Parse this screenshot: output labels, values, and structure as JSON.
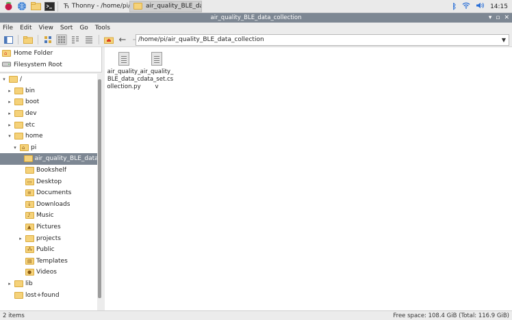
{
  "taskbar": {
    "tasks": [
      {
        "label": "Thonny  -  /home/pi/...",
        "icon": "thonny-icon"
      },
      {
        "label": "air_quality_BLE_data_...",
        "icon": "folder-icon"
      }
    ],
    "clock": "14:15"
  },
  "window": {
    "title": "air_quality_BLE_data_collection"
  },
  "menu": [
    "File",
    "Edit",
    "View",
    "Sort",
    "Go",
    "Tools"
  ],
  "toolbar": {
    "path": "/home/pi/air_quality_BLE_data_collection"
  },
  "places": [
    {
      "label": "Home Folder",
      "icon": "home-icon"
    },
    {
      "label": "Filesystem Root",
      "icon": "drive-icon"
    }
  ],
  "tree": [
    {
      "label": "/",
      "indent": 0,
      "expander": "▾",
      "glyph": ""
    },
    {
      "label": "bin",
      "indent": 1,
      "expander": "▸",
      "glyph": ""
    },
    {
      "label": "boot",
      "indent": 1,
      "expander": "▸",
      "glyph": ""
    },
    {
      "label": "dev",
      "indent": 1,
      "expander": "▸",
      "glyph": ""
    },
    {
      "label": "etc",
      "indent": 1,
      "expander": "▸",
      "glyph": ""
    },
    {
      "label": "home",
      "indent": 1,
      "expander": "▾",
      "glyph": ""
    },
    {
      "label": "pi",
      "indent": 2,
      "expander": "▾",
      "glyph": "⌂"
    },
    {
      "label": "air_quality_BLE_data_collection",
      "indent": 3,
      "expander": "",
      "glyph": "",
      "selected": true
    },
    {
      "label": "Bookshelf",
      "indent": 3,
      "expander": "",
      "glyph": ""
    },
    {
      "label": "Desktop",
      "indent": 3,
      "expander": "",
      "glyph": "▭"
    },
    {
      "label": "Documents",
      "indent": 3,
      "expander": "",
      "glyph": "≡"
    },
    {
      "label": "Downloads",
      "indent": 3,
      "expander": "",
      "glyph": "↓"
    },
    {
      "label": "Music",
      "indent": 3,
      "expander": "",
      "glyph": "♪"
    },
    {
      "label": "Pictures",
      "indent": 3,
      "expander": "",
      "glyph": "▲"
    },
    {
      "label": "projects",
      "indent": 3,
      "expander": "▸",
      "glyph": ""
    },
    {
      "label": "Public",
      "indent": 3,
      "expander": "",
      "glyph": "⁂"
    },
    {
      "label": "Templates",
      "indent": 3,
      "expander": "",
      "glyph": "▤"
    },
    {
      "label": "Videos",
      "indent": 3,
      "expander": "",
      "glyph": "●"
    },
    {
      "label": "lib",
      "indent": 1,
      "expander": "▸",
      "glyph": ""
    },
    {
      "label": "lost+found",
      "indent": 1,
      "expander": "",
      "glyph": ""
    }
  ],
  "files": [
    {
      "name": "air_quality_BLE_data_collection.py"
    },
    {
      "name": "air_quality_data_set.csv"
    }
  ],
  "status": {
    "left": "2 items",
    "right": "Free space: 108.4 GiB (Total: 116.9 GiB)"
  }
}
